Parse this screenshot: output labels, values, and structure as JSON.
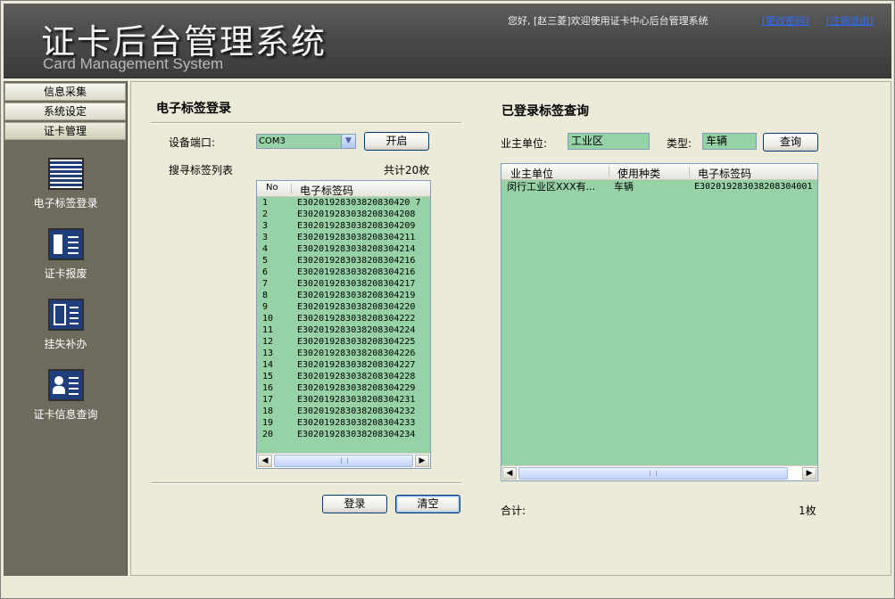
{
  "header": {
    "title": "证卡后台管理系统",
    "subtitle": "Card Management System",
    "welcome": "您好, [赵三菱]欢迎使用证卡中心后台管理系统",
    "change_password": "[更改密码]",
    "logout": "[注销退出]"
  },
  "sidebar": {
    "tabs": [
      "信息采集",
      "系统设定",
      "证卡管理"
    ],
    "items": [
      {
        "label": "电子标签登录",
        "icon": "list-icon"
      },
      {
        "label": "证卡报废",
        "icon": "card-scrap-icon"
      },
      {
        "label": "挂失补办",
        "icon": "report-loss-icon"
      },
      {
        "label": "证卡信息查询",
        "icon": "card-info-icon"
      }
    ]
  },
  "left_panel": {
    "title": "电子标签登录",
    "port_label": "设备端口:",
    "port_value": "COM3",
    "open_button": "开启",
    "list_label": "搜寻标签列表",
    "count_label": "共计20枚",
    "columns": [
      "No",
      "电子标签码"
    ],
    "rows": [
      {
        "no": "1",
        "code": "E30201928303820830420 7"
      },
      {
        "no": "2",
        "code": "E302019283038208304208"
      },
      {
        "no": "3",
        "code": "E302019283038208304209"
      },
      {
        "no": "3",
        "code": "E302019283038208304211"
      },
      {
        "no": "4",
        "code": "E302019283038208304214"
      },
      {
        "no": "5",
        "code": "E302019283038208304216"
      },
      {
        "no": "6",
        "code": "E302019283038208304216"
      },
      {
        "no": "7",
        "code": "E302019283038208304217"
      },
      {
        "no": "8",
        "code": "E302019283038208304219"
      },
      {
        "no": "9",
        "code": "E302019283038208304220"
      },
      {
        "no": "10",
        "code": "E302019283038208304222"
      },
      {
        "no": "11",
        "code": "E302019283038208304224"
      },
      {
        "no": "12",
        "code": "E302019283038208304225"
      },
      {
        "no": "13",
        "code": "E302019283038208304226"
      },
      {
        "no": "14",
        "code": "E302019283038208304227"
      },
      {
        "no": "15",
        "code": "E302019283038208304228"
      },
      {
        "no": "16",
        "code": "E302019283038208304229"
      },
      {
        "no": "17",
        "code": "E302019283038208304231"
      },
      {
        "no": "18",
        "code": "E302019283038208304232"
      },
      {
        "no": "19",
        "code": "E302019283038208304233"
      },
      {
        "no": "20",
        "code": "E302019283038208304234"
      }
    ],
    "login_button": "登录",
    "clear_button": "清空"
  },
  "right_panel": {
    "title": "已登录标签查询",
    "owner_label": "业主单位:",
    "owner_value": "工业区",
    "type_label": "类型:",
    "type_value": "车辆",
    "query_button": "查询",
    "columns": [
      "业主单位",
      "使用种类",
      "电子标签码"
    ],
    "rows": [
      {
        "owner": "闵行工业区XXX有...",
        "kind": "车辆",
        "code": "E302019283038208304001"
      }
    ],
    "total_label": "合计:",
    "total_value": "1枚"
  }
}
